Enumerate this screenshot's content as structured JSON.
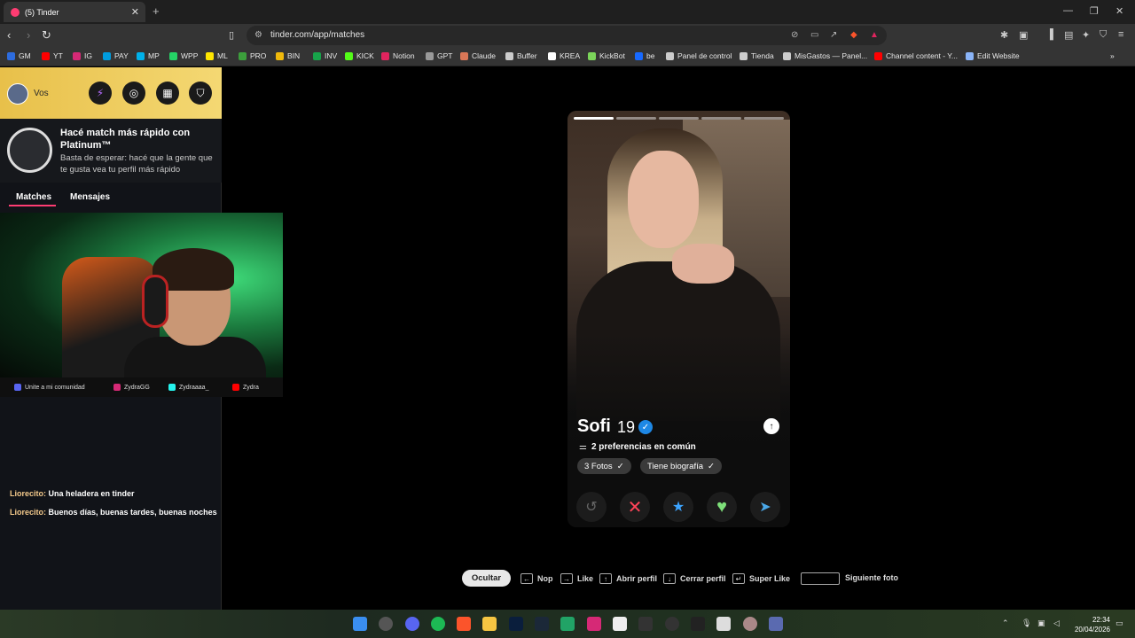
{
  "browser": {
    "tab_title": "(5) Tinder",
    "url": "tinder.com/app/matches",
    "bookmarks": [
      {
        "label": "GM",
        "color": "#2d6cdf"
      },
      {
        "label": "YT",
        "color": "#ff0000"
      },
      {
        "label": "IG",
        "color": "#d62976"
      },
      {
        "label": "PAY",
        "color": "#009cde"
      },
      {
        "label": "MP",
        "color": "#00b1ea"
      },
      {
        "label": "WPP",
        "color": "#25d366"
      },
      {
        "label": "ML",
        "color": "#ffe600"
      },
      {
        "label": "PRO",
        "color": "#3c9f3c"
      },
      {
        "label": "BIN",
        "color": "#f0b90b"
      },
      {
        "label": "INV",
        "color": "#17a34a"
      },
      {
        "label": "KICK",
        "color": "#53fc18"
      },
      {
        "label": "Notion",
        "color": "#e0245e"
      },
      {
        "label": "GPT",
        "color": "#999999"
      },
      {
        "label": "Claude",
        "color": "#d97757"
      },
      {
        "label": "Buffer",
        "color": "#cccccc"
      },
      {
        "label": "KREA",
        "color": "#ffffff"
      },
      {
        "label": "KickBot",
        "color": "#7bd55a"
      },
      {
        "label": "be",
        "color": "#1769ff"
      },
      {
        "label": "Panel de control",
        "color": "#cccccc"
      },
      {
        "label": "Tienda",
        "color": "#cccccc"
      },
      {
        "label": "MisGastos — Panel...",
        "color": "#cccccc"
      },
      {
        "label": "Channel content - Y...",
        "color": "#ff0000"
      },
      {
        "label": "Edit Website",
        "color": "#8ab4f8"
      }
    ]
  },
  "sidebar": {
    "user_label": "Vos",
    "promo_title": "Hacé match más rápido con Platinum™",
    "promo_subtitle": "Basta de esperar: hacé que la gente que te gusta vea tu perfil más rápido",
    "tabs": [
      "Matches",
      "Mensajes"
    ]
  },
  "overlay": {
    "socials": [
      {
        "label": "Unite a mi comunidad",
        "color": "#5865f2"
      },
      {
        "label": "ZydraGG",
        "color": "#d62976"
      },
      {
        "label": "Zydraaaa_",
        "color": "#25f4ee"
      },
      {
        "label": "Zydra",
        "color": "#ff0000"
      }
    ],
    "chat": [
      {
        "user": "Liorecito:",
        "text": "Una heladera en tinder"
      },
      {
        "user": "Liorecito:",
        "text": "Buenos días, buenas tardes, buenas noches"
      }
    ]
  },
  "profile": {
    "name": "Sofi",
    "age": "19",
    "preferences": "2 preferencias en común",
    "pills": [
      "3 Fotos",
      "Tiene biografía"
    ],
    "photo_count": 5
  },
  "shortcuts": {
    "hide": "Ocultar",
    "items": [
      "Nop",
      "Like",
      "Abrir perfil",
      "Cerrar perfil",
      "Super Like",
      "Siguiente foto"
    ]
  },
  "taskbar": {
    "time": "22:34",
    "date": "20/04/2026"
  }
}
